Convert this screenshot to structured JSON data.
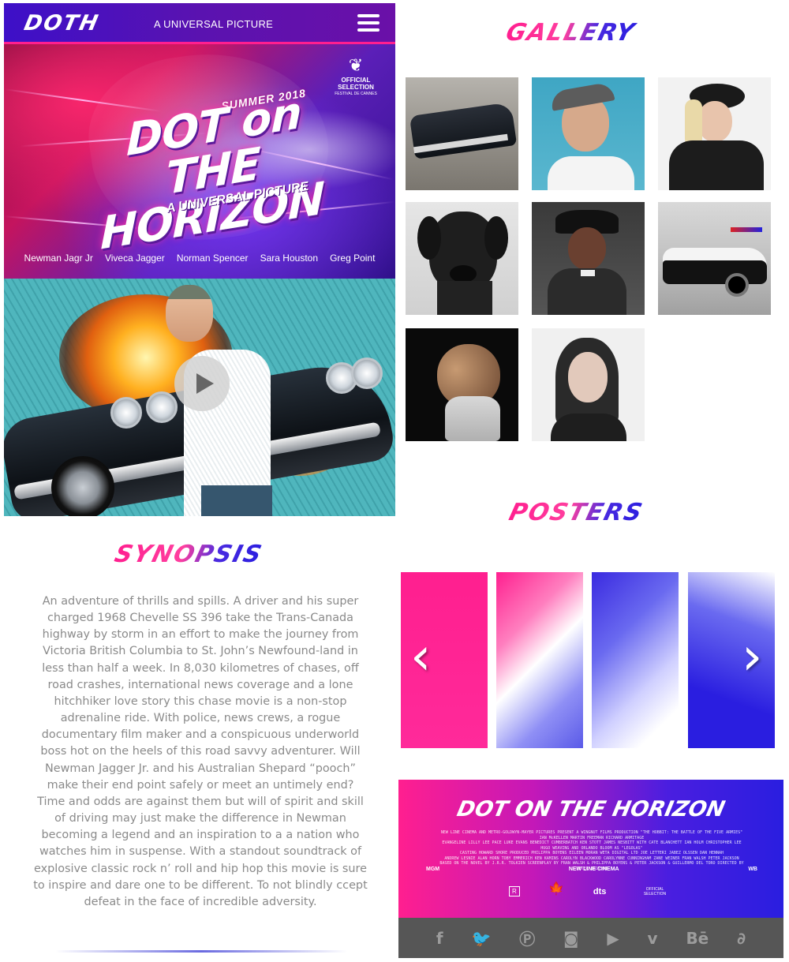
{
  "header": {
    "logo": "DOTH",
    "tagline": "A UNIVERSAL PICTURE",
    "menu_icon": "hamburger-menu-icon"
  },
  "hero": {
    "summer": "SUMMER 2018",
    "title_line1": "DOT on THE",
    "title_line2": "HORIZON",
    "subtitle": "A UNIVERSAL PICTURE",
    "official_selection": "OFFICIAL SELECTION",
    "festival": "FESTIVAL DE CANNES",
    "cast": [
      "Newman Jagr Jr",
      "Viveca Jagger",
      "Norman Spencer",
      "Sara Houston",
      "Greg Point"
    ]
  },
  "video": {
    "play_icon": "play-icon"
  },
  "gallery": {
    "title": "GALLERY"
  },
  "synopsis": {
    "title": "SYNOPSIS",
    "text": "An adventure of thrills and spills. A driver and his super charged 1968 Chevelle SS 396 take the Trans-Canada highway by storm in an effort to make the journey from Victoria British Columbia to St. John’s Newfound-land in less than half a week. In 8,030 kilometres of chases, off road crashes, international news coverage and a lone hitchhiker love story this chase movie is a non-stop adrenaline ride. With police, news crews, a rogue documentary film maker and a conspicuous underworld boss hot on the heels of this road savvy adventurer. Will Newman Jagger Jr. and his Australian Shepard “pooch” make their end point safely or meet an untimely end? Time and odds are against them but will of spirit and skill of driving may just make the difference in Newman becoming a legend and an inspiration to a a nation who watches him in suspense. With a standout soundtrack of explosive classic rock n’ roll and hip hop this movie is sure to inspire and dare one to be different. To not blindly ccept defeat in the face of incredible adversity."
  },
  "posters": {
    "title": "POSTERS",
    "prev": "‹",
    "next": "›"
  },
  "banner": {
    "title": "DOT ON THE HORIZON",
    "credits_line1": "NEW LINE CINEMA AND METRO-GOLDWYN-MAYER PICTURES PRESENT A WINGNUT FILMS PRODUCTION \"THE HOBBIT: THE BATTLE OF THE FIVE ARMIES\" IAN McKELLEN MARTIN FREEMAN RICHARD ARMITAGE",
    "credits_line2": "EVANGELINE LILLY LEE PACE LUKE EVANS BENEDICT CUMBERBATCH KEN STOTT JAMES NESBITT WITH CATE BLANCHETT IAN HOLM CHRISTOPHER LEE HUGO WEAVING AND ORLANDO BLOOM AS \"LEGOLAS\"",
    "credits_line3": "CASTING HOWARD SHORE PRODUCED PHILIPPA BOYENS EILEEN MORAN WETA DIGITAL LTD JOE LETTERI JABEZ OLSSEN DAN HENNAH",
    "credits_line4": "ANDREW LESNIE ALAN HORN TOBY EMMERICH KEN KAMINS CAROLYN BLACKWOOD CAROLYNNE CUNNINGHAM ZANE WEINER FRAN WALSH PETER JACKSON",
    "credits_line5": "BASED ON THE NOVEL BY J.R.R. TOLKIEN SCREENPLAY BY FRAN WALSH & PHILIPPA BOYENS & PETER JACKSON & GUILLERMO DEL TORO DIRECTED BY PETER JACKSON",
    "studio_mgm": "MGM",
    "studio_nl": "NEW LINE CINEMA",
    "studio_wb": "WB",
    "rating": "R",
    "dts": "dts",
    "cannes": "OFFICIAL SELECTION"
  },
  "social": {
    "icons": [
      "facebook-icon",
      "twitter-icon",
      "pinterest-icon",
      "instagram-icon",
      "youtube-icon",
      "vimeo-icon",
      "behance-icon",
      "deviantart-icon"
    ]
  },
  "colors": {
    "accent_pink": "#ff1f8f",
    "accent_blue": "#2a1ee0",
    "header_purple": "#3d10c8",
    "footer_gray": "#565656",
    "synopsis_text": "#8a8a8a"
  }
}
